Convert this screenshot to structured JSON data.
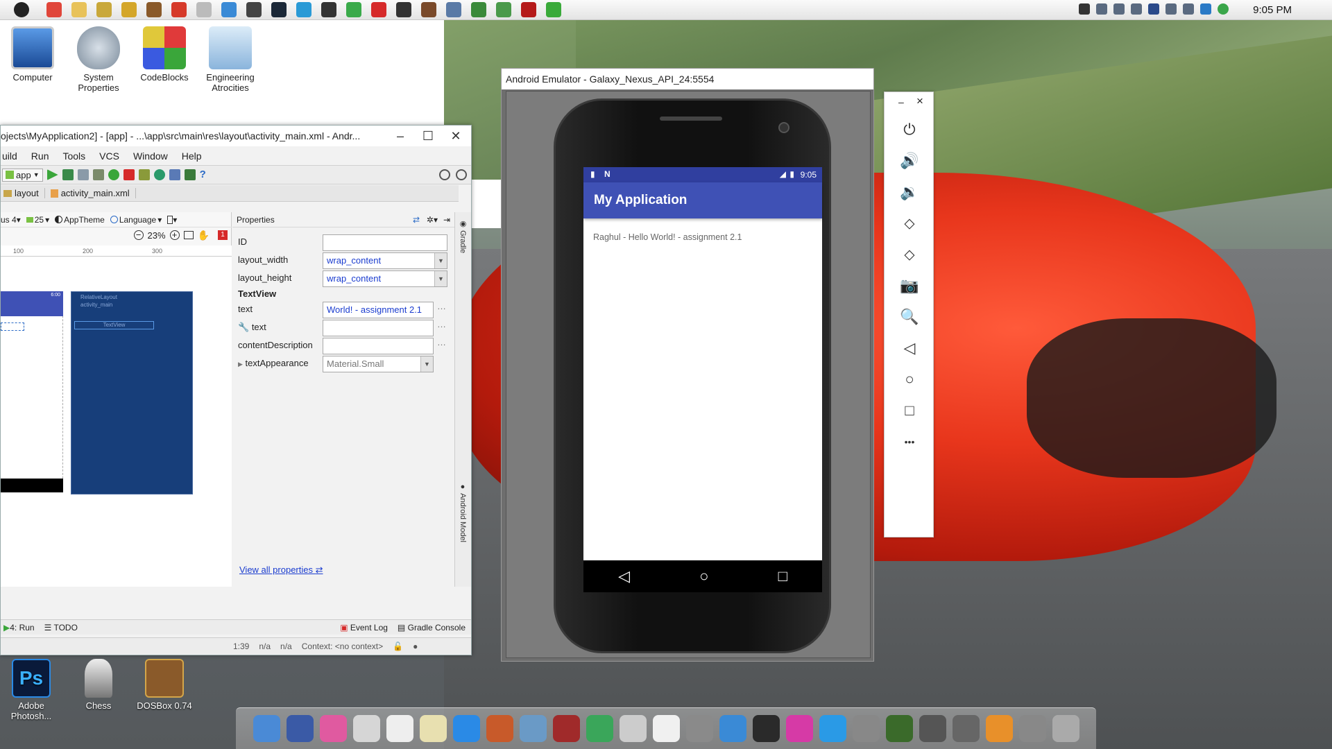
{
  "top_bar": {
    "clock": "9:05 PM",
    "apps": [
      {
        "icon": "apple-icon",
        "color": "#222222"
      },
      {
        "icon": "chrome-icon",
        "color": "#e0463a"
      },
      {
        "icon": "folder-icon",
        "color": "#e8c25a"
      },
      {
        "icon": "wrench-icon",
        "color": "#c9a83a"
      },
      {
        "icon": "r-app-icon",
        "color": "#d4a629"
      },
      {
        "icon": "box-icon",
        "color": "#8a5a2a"
      },
      {
        "icon": "p-app-icon",
        "color": "#d63a2a"
      },
      {
        "icon": "feather-icon",
        "color": "#bbbbbb"
      },
      {
        "icon": "sync-icon",
        "color": "#3a8ad6"
      },
      {
        "icon": "monitor-icon",
        "color": "#444444"
      },
      {
        "icon": "steam-icon",
        "color": "#1b2838"
      },
      {
        "icon": "share-icon",
        "color": "#2a9ad6"
      },
      {
        "icon": "gear-icon",
        "color": "#333333"
      },
      {
        "icon": "doc-icon",
        "color": "#3aaa4a"
      },
      {
        "icon": "download-icon",
        "color": "#d62a2a"
      },
      {
        "icon": "media-icon",
        "color": "#333333"
      },
      {
        "icon": "fruit-icon",
        "color": "#7a4a2a"
      },
      {
        "icon": "settings-icon",
        "color": "#5a7aa6"
      },
      {
        "icon": "globe-icon",
        "color": "#3a8a3a"
      },
      {
        "icon": "android-icon",
        "color": "#4a9a4a"
      },
      {
        "icon": "acrobat-icon",
        "color": "#b51a1a"
      },
      {
        "icon": "phone-icon",
        "color": "#3aaa3a"
      }
    ]
  },
  "desktop_icons": [
    {
      "label": "Computer",
      "color": "#3a7ad6"
    },
    {
      "label": "System Properties",
      "color": "#a8b8c8"
    },
    {
      "label": "CodeBlocks",
      "color": "#e03a3a"
    },
    {
      "label": "Engineering Atrocities",
      "color": "#b8d4ec"
    }
  ],
  "desktop_icons_bottom": [
    {
      "label": "Adobe Photosh...",
      "color": "#0a1a3a"
    },
    {
      "label": "Chess",
      "color": "#777777"
    },
    {
      "label": "DOSBox 0.74",
      "color": "#8a5a2a"
    }
  ],
  "ide": {
    "title": "ojects\\MyApplication2] - [app] - ...\\app\\src\\main\\res\\layout\\activity_main.xml - Andr...",
    "menu": [
      "uild",
      "Run",
      "Tools",
      "VCS",
      "Window",
      "Help"
    ],
    "run_config": "app",
    "breadcrumb": [
      "layout",
      "activity_main.xml"
    ],
    "design_toolbar": [
      "us 4",
      "25",
      "AppTheme",
      "Language"
    ],
    "zoom": "23%",
    "ruler_ticks": [
      "100",
      "200",
      "300"
    ],
    "preview_time": "6:00",
    "blueprint_label_1": "RelativeLayout",
    "blueprint_label_2": "activity_main",
    "blueprint_textview": "TextView",
    "error_badge": "1",
    "properties": {
      "header": "Properties",
      "rows": [
        {
          "label": "ID",
          "value": ""
        },
        {
          "label": "layout_width",
          "value": "wrap_content"
        },
        {
          "label": "layout_height",
          "value": "wrap_content"
        }
      ],
      "section": "TextView",
      "rows2": [
        {
          "label": "text",
          "value": "World! - assignment 2.1"
        },
        {
          "label": "text",
          "value": ""
        },
        {
          "label": "contentDescription",
          "value": ""
        },
        {
          "label": "textAppearance",
          "value": "Material.Small"
        }
      ],
      "view_all": "View all properties"
    },
    "side_tabs": [
      "Gradle",
      "Android Model"
    ],
    "bottom_tabs": [
      "4: Run",
      "TODO",
      "Event Log",
      "Gradle Console"
    ],
    "status": [
      "1:39",
      "n/a",
      "n/a",
      "Context: <no context>"
    ]
  },
  "emulator": {
    "title": "Android Emulator - Galaxy_Nexus_API_24:5554",
    "status_time": "9:05",
    "app_title": "My Application",
    "hello_text": "Raghul - Hello World! - assignment 2.1",
    "panel_min": "–",
    "panel_close": "×",
    "panel_buttons": [
      "power-icon",
      "volume-up-icon",
      "volume-down-icon",
      "rotate-left-icon",
      "rotate-right-icon",
      "camera-icon",
      "zoom-icon",
      "back-icon",
      "home-icon",
      "overview-icon",
      "more-icon"
    ],
    "panel_glyphs": [
      "⏻",
      "🔊",
      "🔉",
      "⬦",
      "⬦",
      "📷",
      "🔍",
      "◁",
      "○",
      "□",
      "•••"
    ]
  },
  "dock": [
    {
      "icon": "finder-icon",
      "color": "#4a8ad6"
    },
    {
      "icon": "bluetooth-icon",
      "color": "#3a5aa6"
    },
    {
      "icon": "color-wheel-icon",
      "color": "#e05aa0"
    },
    {
      "icon": "calculator-icon",
      "color": "#d6d6d6"
    },
    {
      "icon": "mouse-icon",
      "color": "#eeeeee"
    },
    {
      "icon": "notes-icon",
      "color": "#e8e0b0"
    },
    {
      "icon": "safari-icon",
      "color": "#2a8ae6"
    },
    {
      "icon": "pen-icon",
      "color": "#c85a2a"
    },
    {
      "icon": "preview-icon",
      "color": "#6a9ac6"
    },
    {
      "icon": "photobooth-icon",
      "color": "#a02a2a"
    },
    {
      "icon": "globe-icon",
      "color": "#3aa65a"
    },
    {
      "icon": "disk-icon",
      "color": "#cccccc"
    },
    {
      "icon": "x-icon",
      "color": "#f0f0f0"
    },
    {
      "icon": "system-prefs-icon",
      "color": "#8a8a8a"
    },
    {
      "icon": "windows-icon",
      "color": "#3a8ad6"
    },
    {
      "icon": "display-icon",
      "color": "#2a2a2a"
    },
    {
      "icon": "itunes-icon",
      "color": "#d63aa6"
    },
    {
      "icon": "appstore-icon",
      "color": "#2a9ae6"
    },
    {
      "icon": "alien-icon",
      "color": "#888888"
    },
    {
      "icon": "v-icon",
      "color": "#3a6a2a"
    },
    {
      "icon": "camera-app-icon",
      "color": "#555555"
    },
    {
      "icon": "send-icon",
      "color": "#666666"
    },
    {
      "icon": "ibooks-icon",
      "color": "#e8902a"
    },
    {
      "icon": "shutdown-icon",
      "color": "#888888"
    },
    {
      "icon": "trash-icon",
      "color": "#aaaaaa"
    }
  ]
}
